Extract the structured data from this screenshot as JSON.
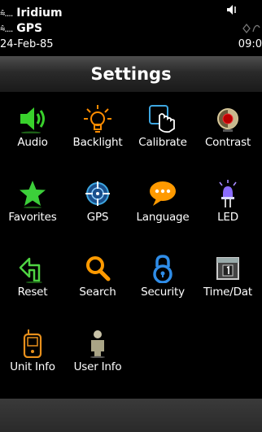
{
  "status": {
    "satellite_label": "Iridium",
    "gps_label": "GPS",
    "date": "24-Feb-85",
    "time": "09:0"
  },
  "header": {
    "title": "Settings"
  },
  "grid": {
    "items": [
      {
        "label": "Audio",
        "icon": "speaker-icon"
      },
      {
        "label": "Backlight",
        "icon": "lightbulb-icon"
      },
      {
        "label": "Calibrate",
        "icon": "touch-hand-icon"
      },
      {
        "label": "Contrast",
        "icon": "contrast-icon"
      },
      {
        "label": "Favorites",
        "icon": "star-icon"
      },
      {
        "label": "GPS",
        "icon": "gps-crosshair-icon"
      },
      {
        "label": "Language",
        "icon": "speech-bubble-icon"
      },
      {
        "label": "LED",
        "icon": "led-lamp-icon"
      },
      {
        "label": "Reset",
        "icon": "reset-arrow-icon"
      },
      {
        "label": "Search",
        "icon": "magnifier-icon"
      },
      {
        "label": "Security",
        "icon": "padlock-icon"
      },
      {
        "label": "Time/Dat",
        "icon": "calendar-icon"
      },
      {
        "label": "Unit Info",
        "icon": "handheld-device-icon"
      },
      {
        "label": "User Info",
        "icon": "person-icon"
      }
    ]
  },
  "colors": {
    "background": "#000000",
    "title_bar": "#2a2a2a",
    "audio_green": "#39d12c",
    "backlight_orange": "#ff8c00",
    "calibrate_blue": "#3ea6e0",
    "favorites_green": "#3ccf3a",
    "language_orange": "#ff9a00",
    "led_purple": "#8a6cff",
    "search_orange": "#ff9a00",
    "security_blue": "#2f8de8"
  }
}
